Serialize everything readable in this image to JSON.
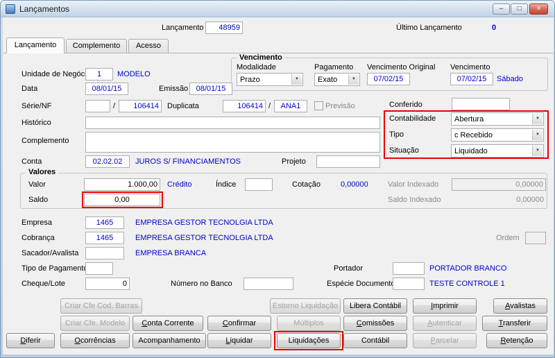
{
  "window": {
    "title": "Lançamentos",
    "controls": {
      "minimize": "–",
      "maximize": "□",
      "close": "×"
    }
  },
  "icons": {
    "dropdown": "▼"
  },
  "header": {
    "lancamento_label": "Lançamento",
    "lancamento_value": "48959",
    "ultimo_lancamento_label": "Último Lançamento",
    "ultimo_lancamento_value": "0"
  },
  "tabs": {
    "lancamento": "Lançamento",
    "complemento": "Complemento",
    "acesso": "Acesso"
  },
  "fields": {
    "unidade_label": "Unidade de Negócio",
    "unidade_value": "1",
    "unidade_desc": "MODELO",
    "data_label": "Data",
    "data_value": "08/01/15",
    "emissao_label": "Emissão",
    "emissao_value": "08/01/15",
    "serie_label": "Série/NF",
    "serie_sep": "/",
    "serie_nf_value": "106414",
    "duplicata_label": "Duplicata",
    "duplicata_value": "106414",
    "duplicata_sep": "/",
    "duplicata_seq": "ANA1",
    "previsao_label": "Previsão",
    "conferido_label": "Conferido",
    "historico_label": "Histórico",
    "complemento_label": "Complemento",
    "conta_label": "Conta",
    "conta_value": "02.02.02",
    "conta_desc": "JUROS S/ FINANCIAMENTOS",
    "projeto_label": "Projeto"
  },
  "vencimento": {
    "title": "Vencimento",
    "modalidade_label": "Modalidade",
    "modalidade_value": "Prazo",
    "pagamento_label": "Pagamento",
    "pagamento_value": "Exato",
    "original_label": "Vencimento Original",
    "original_value": "07/02/15",
    "venc_label": "Vencimento",
    "venc_value": "07/02/15",
    "weekday": "Sábado"
  },
  "classificacao": {
    "contabilidade_label": "Contabilidade",
    "contabilidade_value": "Abertura",
    "tipo_label": "Tipo",
    "tipo_value": "c Recebido",
    "situacao_label": "Situação",
    "situacao_value": "Liquidado"
  },
  "valores": {
    "title": "Valores",
    "valor_label": "Valor",
    "valor_value": "1.000,00",
    "valor_tipo": "Crédito",
    "indice_label": "Índice",
    "cotacao_label": "Cotação",
    "cotacao_value": "0,00000",
    "valor_indexado_label": "Valor Indexado",
    "valor_indexado_value": "0,00000",
    "saldo_label": "Saldo",
    "saldo_value": "0,00",
    "saldo_indexado_label": "Saldo Indexado",
    "saldo_indexado_value": "0,00000"
  },
  "parties": {
    "empresa_label": "Empresa",
    "empresa_value": "1465",
    "empresa_desc": "EMPRESA GESTOR TECNOLGIA LTDA",
    "cobranca_label": "Cobrança",
    "cobranca_value": "1465",
    "cobranca_desc": "EMPRESA GESTOR TECNOLGIA LTDA",
    "ordem_label": "Ordem",
    "sacador_label": "Sacador/Avalista",
    "sacador_desc": "EMPRESA BRANCA",
    "tipo_pagamento_label": "Tipo de Pagamento",
    "portador_label": "Portador",
    "portador_desc": "PORTADOR BRANCO",
    "cheque_label": "Cheque/Lote",
    "cheque_value": "0",
    "numero_banco_label": "Número no Banco",
    "especie_label": "Espécie Documento",
    "especie_desc": "TESTE CONTROLE 1"
  },
  "buttons": {
    "criar_cfe_barras": "Criar Cfe Cod. Barras",
    "estorno_liquidacao": "Estorno Liquidação",
    "libera_contabil": "Libera Contábil",
    "imprimir": "Imprimir",
    "avalistas": "Avalistas",
    "criar_cfe_modelo": "Criar Cfe. Modelo",
    "conta_corrente": "Conta Corrente",
    "confirmar": "Confirmar",
    "multiplos": "Múltiplos",
    "comissoes": "Comissões",
    "autenticar": "Autenticar",
    "transferir": "Transferir",
    "diferir": "Diferir",
    "ocorrencias": "Ocorrências",
    "acompanhamento": "Acompanhamento",
    "liquidar": "Liquidar",
    "liquidacoes": "Liquidações",
    "contabil": "Contábil",
    "parcelar": "Parcelar",
    "retencao": "Retenção"
  }
}
